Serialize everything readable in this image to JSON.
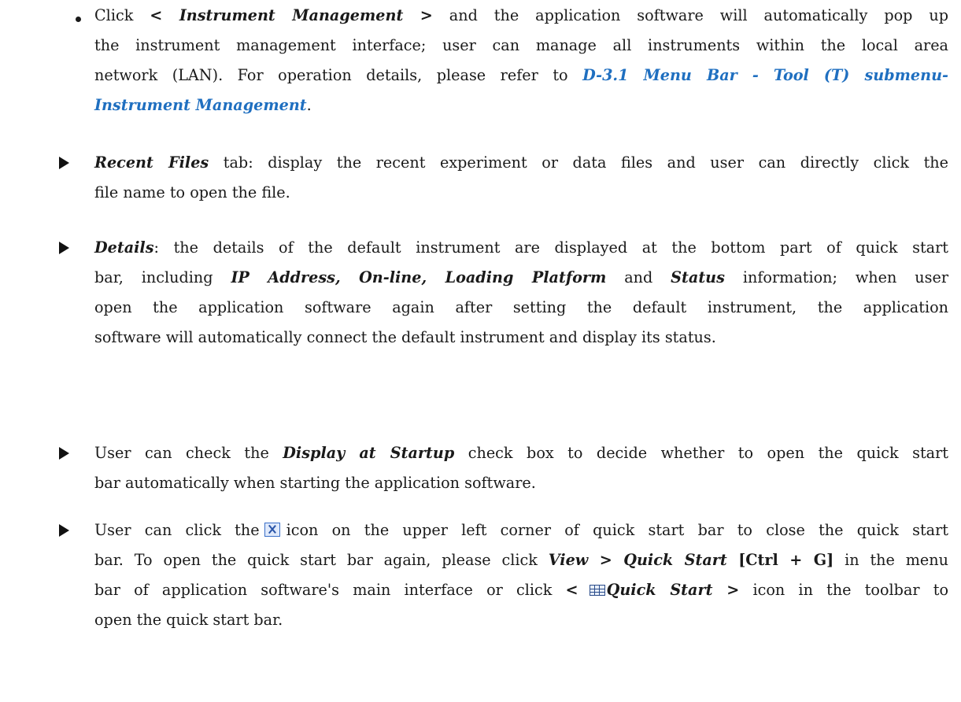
{
  "bullet1": {
    "l1a": "Click ",
    "l1b": "< Instrument Management >",
    "l1c": " and the application software will automatically pop up",
    "l2": "the instrument management interface; user can manage all instruments within the local area",
    "l3a": "network (LAN). For operation details, please refer to ",
    "l3b": "D-3.1 Menu Bar - Tool (T) submenu-",
    "l4a": "Instrument Management",
    "l4b": "."
  },
  "bullet2": {
    "l1a": "Recent Files",
    "l1b": " tab: display the recent experiment or data files and user can directly click the",
    "l2": "file name to open the file."
  },
  "bullet3": {
    "l1a": "Details",
    "l1b": ": the details of the default instrument are displayed at the bottom part of quick start",
    "l2a": "bar, including ",
    "l2b": "IP Address, On-line, Loading Platform",
    "l2c": " and ",
    "l2d": "Status",
    "l2e": " information; when user",
    "l3": "open the application software again after setting the default instrument, the application",
    "l4": "software will automatically connect the default instrument and display its status."
  },
  "bullet4": {
    "l1a": "User can check the ",
    "l1b": "Display at Startup",
    "l1c": " check box to decide whether to open the quick start",
    "l2": "bar automatically when starting the application software."
  },
  "bullet5": {
    "l1a": "User can click the",
    "l1b": "icon on the upper left corner of quick start bar to close the quick start",
    "l2a": "bar. To open the quick start bar again, please click ",
    "l2b": "View > Quick Start",
    "l2c": " [Ctrl + G]",
    "l2d": " in the menu",
    "l3a": "bar of application software's main interface or click ",
    "l3b": "<",
    "l3c": "Quick Start >",
    "l3d": " icon in the toolbar to",
    "l4": "open the quick start bar."
  }
}
